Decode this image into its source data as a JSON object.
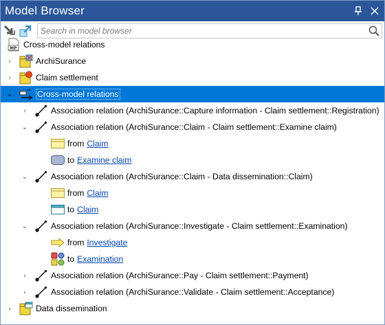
{
  "window": {
    "title": "Model Browser",
    "pin_glyph": "⊥",
    "close_glyph": "✕"
  },
  "toolbar": {
    "search_placeholder": "Search in model browser"
  },
  "tree": {
    "root_label": "Cross-model relations",
    "root_badge": "MP",
    "archisurance": "ArchiSurance",
    "claim_settlement": "Claim settlement",
    "cross_model": "Cross-model relations",
    "rel1": "Association relation (ArchiSurance::Capture information - Claim settlement::Registration)",
    "rel2": "Association relation (ArchiSurance::Claim - Claim settlement::Examine claim)",
    "rel2_from_word": "from",
    "rel2_from_link": "Claim",
    "rel2_to_word": "to",
    "rel2_to_link": "Examine claim",
    "rel3": "Association relation (ArchiSurance::Claim - Data dissemination::Claim)",
    "rel3_from_word": "from",
    "rel3_from_link": "Claim",
    "rel3_to_word": "to",
    "rel3_to_link": "Claim",
    "rel4": "Association relation (ArchiSurance::Investigate - Claim settlement::Examination)",
    "rel4_from_word": "from",
    "rel4_from_link": "Investigate",
    "rel4_to_word": "to",
    "rel4_to_link": "Examination",
    "rel5": "Association relation (ArchiSurance::Pay - Claim settlement::Payment)",
    "rel6": "Association relation (ArchiSurance::Validate - Claim settlement::Acceptance)",
    "data_dissemination": "Data dissemination"
  },
  "colors": {
    "titlebar": "#2b579a",
    "selection": "#0078d7",
    "link": "#0645ad"
  }
}
